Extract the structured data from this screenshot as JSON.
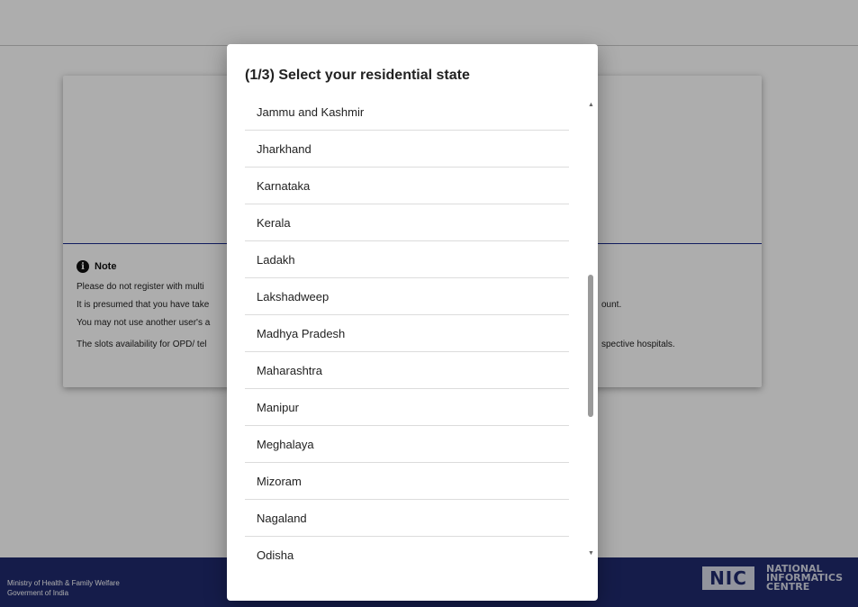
{
  "background": {
    "note": {
      "heading": "Note",
      "lines": [
        "Please do not register with multi",
        "It is presumed that you have take",
        "You may not use another user's a",
        "The slots availability for OPD/ tel"
      ],
      "tails": [
        "ount.",
        "spective hospitals."
      ]
    },
    "footer": {
      "ministry_line1": "Ministry of Health & Family Welfare",
      "ministry_line2": "Goverment of India",
      "nic_logo_text": "NIC",
      "nic_line1": "NATIONAL",
      "nic_line2": "INFORMATICS",
      "nic_line3": "CENTRE"
    }
  },
  "modal": {
    "title": "(1/3) Select your residential state",
    "states": [
      "Jammu and Kashmir",
      "Jharkhand",
      "Karnataka",
      "Kerala",
      "Ladakh",
      "Lakshadweep",
      "Madhya Pradesh",
      "Maharashtra",
      "Manipur",
      "Meghalaya",
      "Mizoram",
      "Nagaland",
      "Odisha"
    ]
  },
  "colors": {
    "footer": "#1f2a6e",
    "divider": "#1a2a8c",
    "overlay": "rgba(0,0,0,0.32)"
  }
}
